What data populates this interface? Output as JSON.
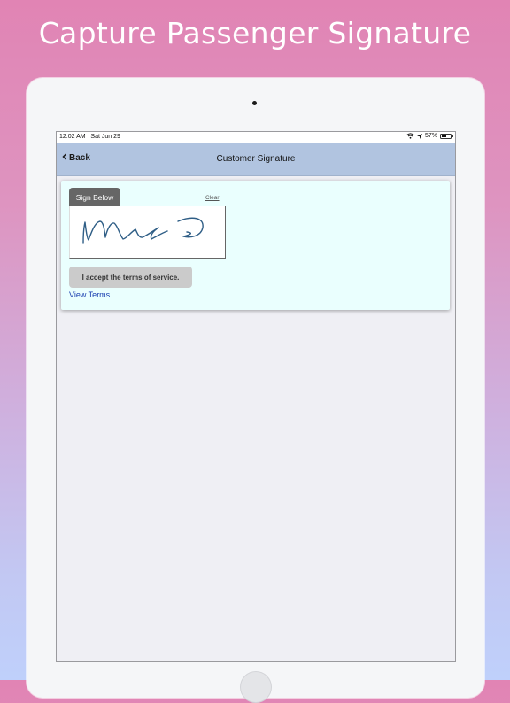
{
  "headline": "Capture Passenger Signature",
  "status_bar": {
    "time": "12:02 AM",
    "date": "Sat Jun 29",
    "battery_percent": "57%",
    "battery_level": 0.57,
    "icons": [
      "wifi-icon",
      "location-icon",
      "battery-icon"
    ]
  },
  "nav": {
    "back_label": "Back",
    "title": "Customer Signature"
  },
  "signature": {
    "tab_label": "Sign Below",
    "clear_label": "Clear",
    "stroke_color": "#2f5e86"
  },
  "accept_button_label": "I accept the terms of service.",
  "view_terms_label": "View Terms",
  "colors": {
    "nav_background": "#b1c4e0",
    "card_background": "#eafffe",
    "link_color": "#1a3fb0",
    "tab_background": "#666666"
  }
}
